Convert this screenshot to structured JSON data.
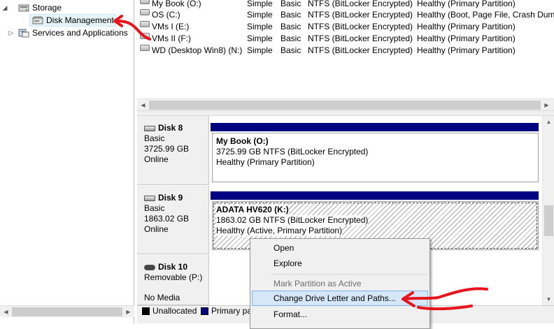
{
  "tree": {
    "items": [
      {
        "label": "Storage",
        "arrow": "◢",
        "icon": "storage-icon"
      },
      {
        "label": "Disk Management",
        "icon": "disk-management-icon"
      },
      {
        "label": "Services and Applications",
        "arrow": "▷",
        "icon": "services-icon"
      }
    ]
  },
  "volumes": [
    {
      "name": "My Book (O:)",
      "layout": "Simple",
      "type": "Basic",
      "fs": "NTFS (BitLocker Encrypted)",
      "status": "Healthy (Primary Partition)"
    },
    {
      "name": "OS (C:)",
      "layout": "Simple",
      "type": "Basic",
      "fs": "NTFS (BitLocker Encrypted)",
      "status": "Healthy (Boot, Page File, Crash Dump"
    },
    {
      "name": "VMs I (E:)",
      "layout": "Simple",
      "type": "Basic",
      "fs": "NTFS (BitLocker Encrypted)",
      "status": "Healthy (Primary Partition)"
    },
    {
      "name": "VMs II (F:)",
      "layout": "Simple",
      "type": "Basic",
      "fs": "NTFS (BitLocker Encrypted)",
      "status": "Healthy (Primary Partition)"
    },
    {
      "name": "WD (Desktop Win8) (N:)",
      "layout": "Simple",
      "type": "Basic",
      "fs": "NTFS (BitLocker Encrypted)",
      "status": "Healthy (Primary Partition)"
    }
  ],
  "disks": [
    {
      "title": "Disk 8",
      "type": "Basic",
      "size": "3725.99 GB",
      "state": "Online",
      "partition": {
        "name": "My Book  (O:)",
        "detail": "3725.99 GB NTFS (BitLocker Encrypted)",
        "status": "Healthy (Primary Partition)"
      }
    },
    {
      "title": "Disk 9",
      "type": "Basic",
      "size": "1863.02 GB",
      "state": "Online",
      "partition": {
        "name": "ADATA HV620  (K:)",
        "detail": "1863.02 GB NTFS (BitLocker Encrypted)",
        "status": "Healthy (Active, Primary Partition)"
      }
    },
    {
      "title": "Disk 10",
      "type": "Removable (P:)",
      "state": "No Media"
    }
  ],
  "legend": {
    "unallocated": "Unallocated",
    "primary": "Primary pa",
    "colors": {
      "unallocated": "#000000",
      "primary": "#000080"
    }
  },
  "context_menu": {
    "items": [
      "Open",
      "Explore",
      "Mark Partition as Active",
      "Change Drive Letter and Paths...",
      "Format..."
    ],
    "highlighted": "Change Drive Letter and Paths...",
    "disabled": [
      "Mark Partition as Active"
    ]
  },
  "colors": {
    "partition_bar": "#000080",
    "annotation": "#e8141c",
    "menu_highlight": "#d5e7f8"
  }
}
